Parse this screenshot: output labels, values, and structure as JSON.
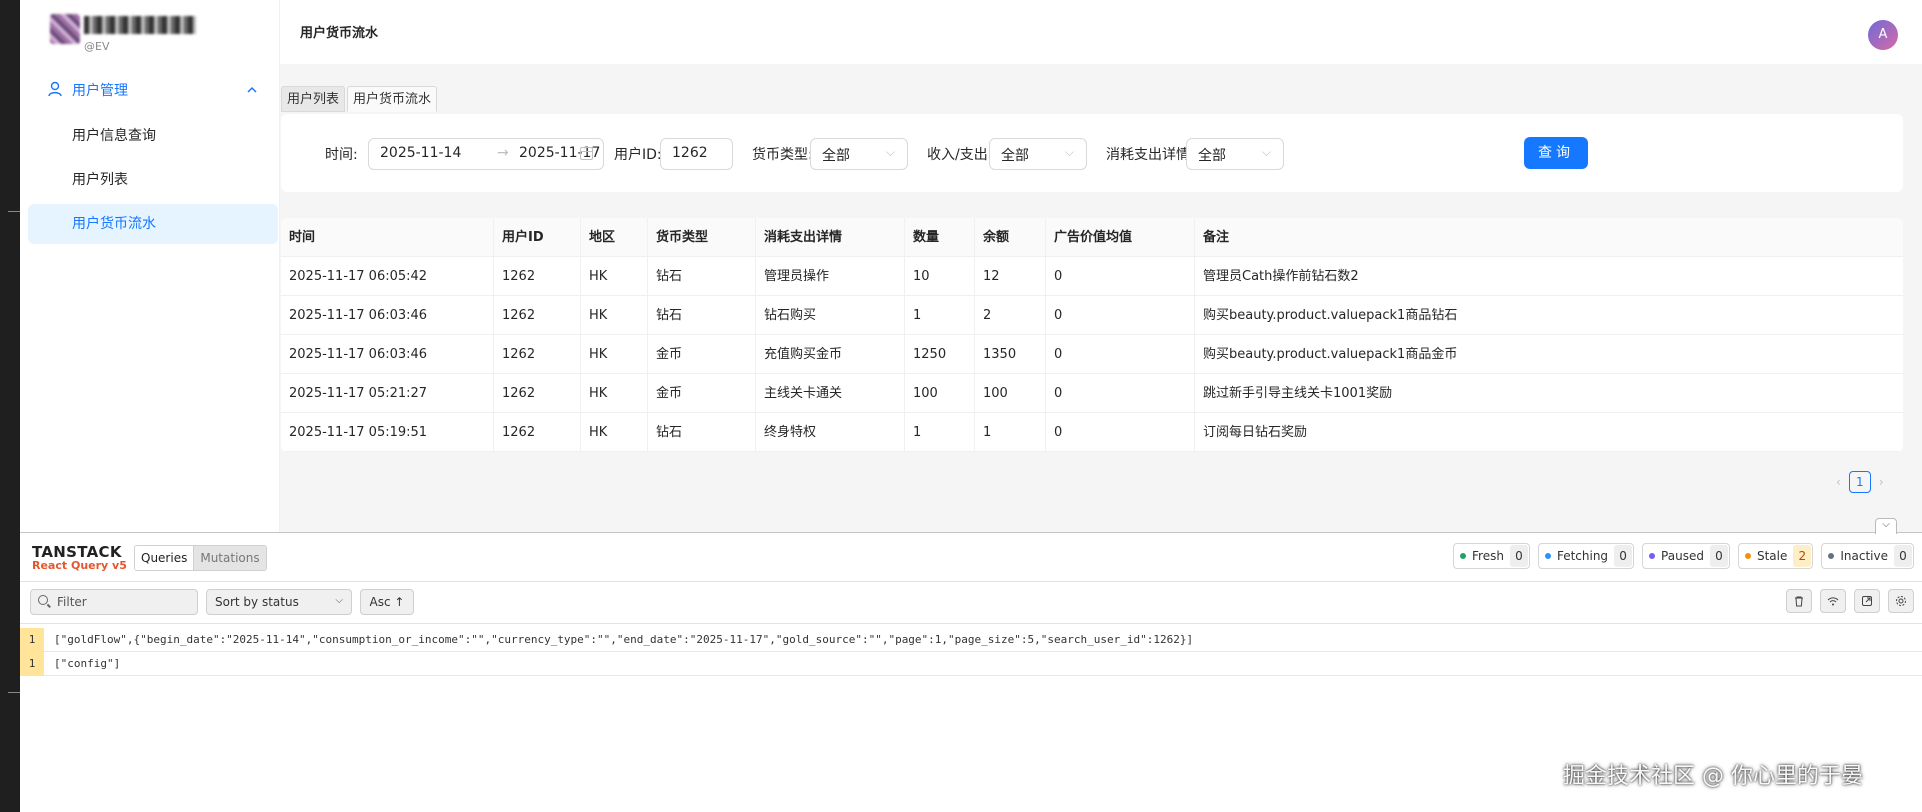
{
  "app": {
    "logo_sub": "@EV"
  },
  "sidebar": {
    "group_label": "用户管理",
    "items": [
      {
        "label": "用户信息查询"
      },
      {
        "label": "用户列表"
      },
      {
        "label": "用户货币流水"
      }
    ]
  },
  "header": {
    "title": "用户货币流水",
    "avatar_letter": "A"
  },
  "tabs": [
    {
      "label": "用户列表"
    },
    {
      "label": "用户货币流水"
    }
  ],
  "filters": {
    "time_label": "时间:",
    "date_start": "2025-11-14",
    "date_sep": "→",
    "date_end": "2025-11-17",
    "user_id_label": "用户ID:",
    "user_id_value": "1262",
    "currency_label": "货币类型:",
    "currency_value": "全部",
    "io_label": "收入/支出:",
    "io_value": "全部",
    "detail_label": "消耗支出详情:",
    "detail_value": "全部",
    "query_button": "查询"
  },
  "table": {
    "columns": [
      "时间",
      "用户ID",
      "地区",
      "货币类型",
      "消耗支出详情",
      "数量",
      "余额",
      "广告价值均值",
      "备注"
    ],
    "rows": [
      [
        "2025-11-17 06:05:42",
        "1262",
        "HK",
        "钻石",
        "管理员操作",
        "10",
        "12",
        "0",
        "管理员Cath操作前钻石数2"
      ],
      [
        "2025-11-17 06:03:46",
        "1262",
        "HK",
        "钻石",
        "钻石购买",
        "1",
        "2",
        "0",
        "购买beauty.product.valuepack1商品钻石"
      ],
      [
        "2025-11-17 06:03:46",
        "1262",
        "HK",
        "金币",
        "充值购买金币",
        "1250",
        "1350",
        "0",
        "购买beauty.product.valuepack1商品金币"
      ],
      [
        "2025-11-17 05:21:27",
        "1262",
        "HK",
        "金币",
        "主线关卡通关",
        "100",
        "100",
        "0",
        "跳过新手引导主线关卡1001奖励"
      ],
      [
        "2025-11-17 05:19:51",
        "1262",
        "HK",
        "钻石",
        "终身特权",
        "1",
        "1",
        "0",
        "订阅每日钻石奖励"
      ]
    ]
  },
  "pagination": {
    "prev": "‹",
    "current": "1",
    "next": "›"
  },
  "devtools": {
    "brand_top": "TANSTACK",
    "brand_bottom": "React Query v5",
    "tab_queries": "Queries",
    "tab_mutations": "Mutations",
    "statuses": [
      {
        "label": "Fresh",
        "count": "0",
        "color": "#22a06b"
      },
      {
        "label": "Fetching",
        "count": "0",
        "color": "#2e90fa"
      },
      {
        "label": "Paused",
        "count": "0",
        "color": "#7a5af8"
      },
      {
        "label": "Stale",
        "count": "2",
        "color": "#f79009"
      },
      {
        "label": "Inactive",
        "count": "0",
        "color": "#667085"
      }
    ],
    "filter_placeholder": "Filter",
    "sort_value": "Sort by status",
    "sort_dir": "Asc ↑",
    "queries": [
      {
        "count": "1",
        "key": "[\"goldFlow\",{\"begin_date\":\"2025-11-14\",\"consumption_or_income\":\"\",\"currency_type\":\"\",\"end_date\":\"2025-11-17\",\"gold_source\":\"\",\"page\":1,\"page_size\":5,\"search_user_id\":1262}]"
      },
      {
        "count": "1",
        "key": "[\"config\"]"
      }
    ]
  },
  "watermark": "掘金技术社区 @ 你心里的于晏",
  "colors": {
    "accent": "#1677ff",
    "active_bg": "#e6f4ff"
  }
}
